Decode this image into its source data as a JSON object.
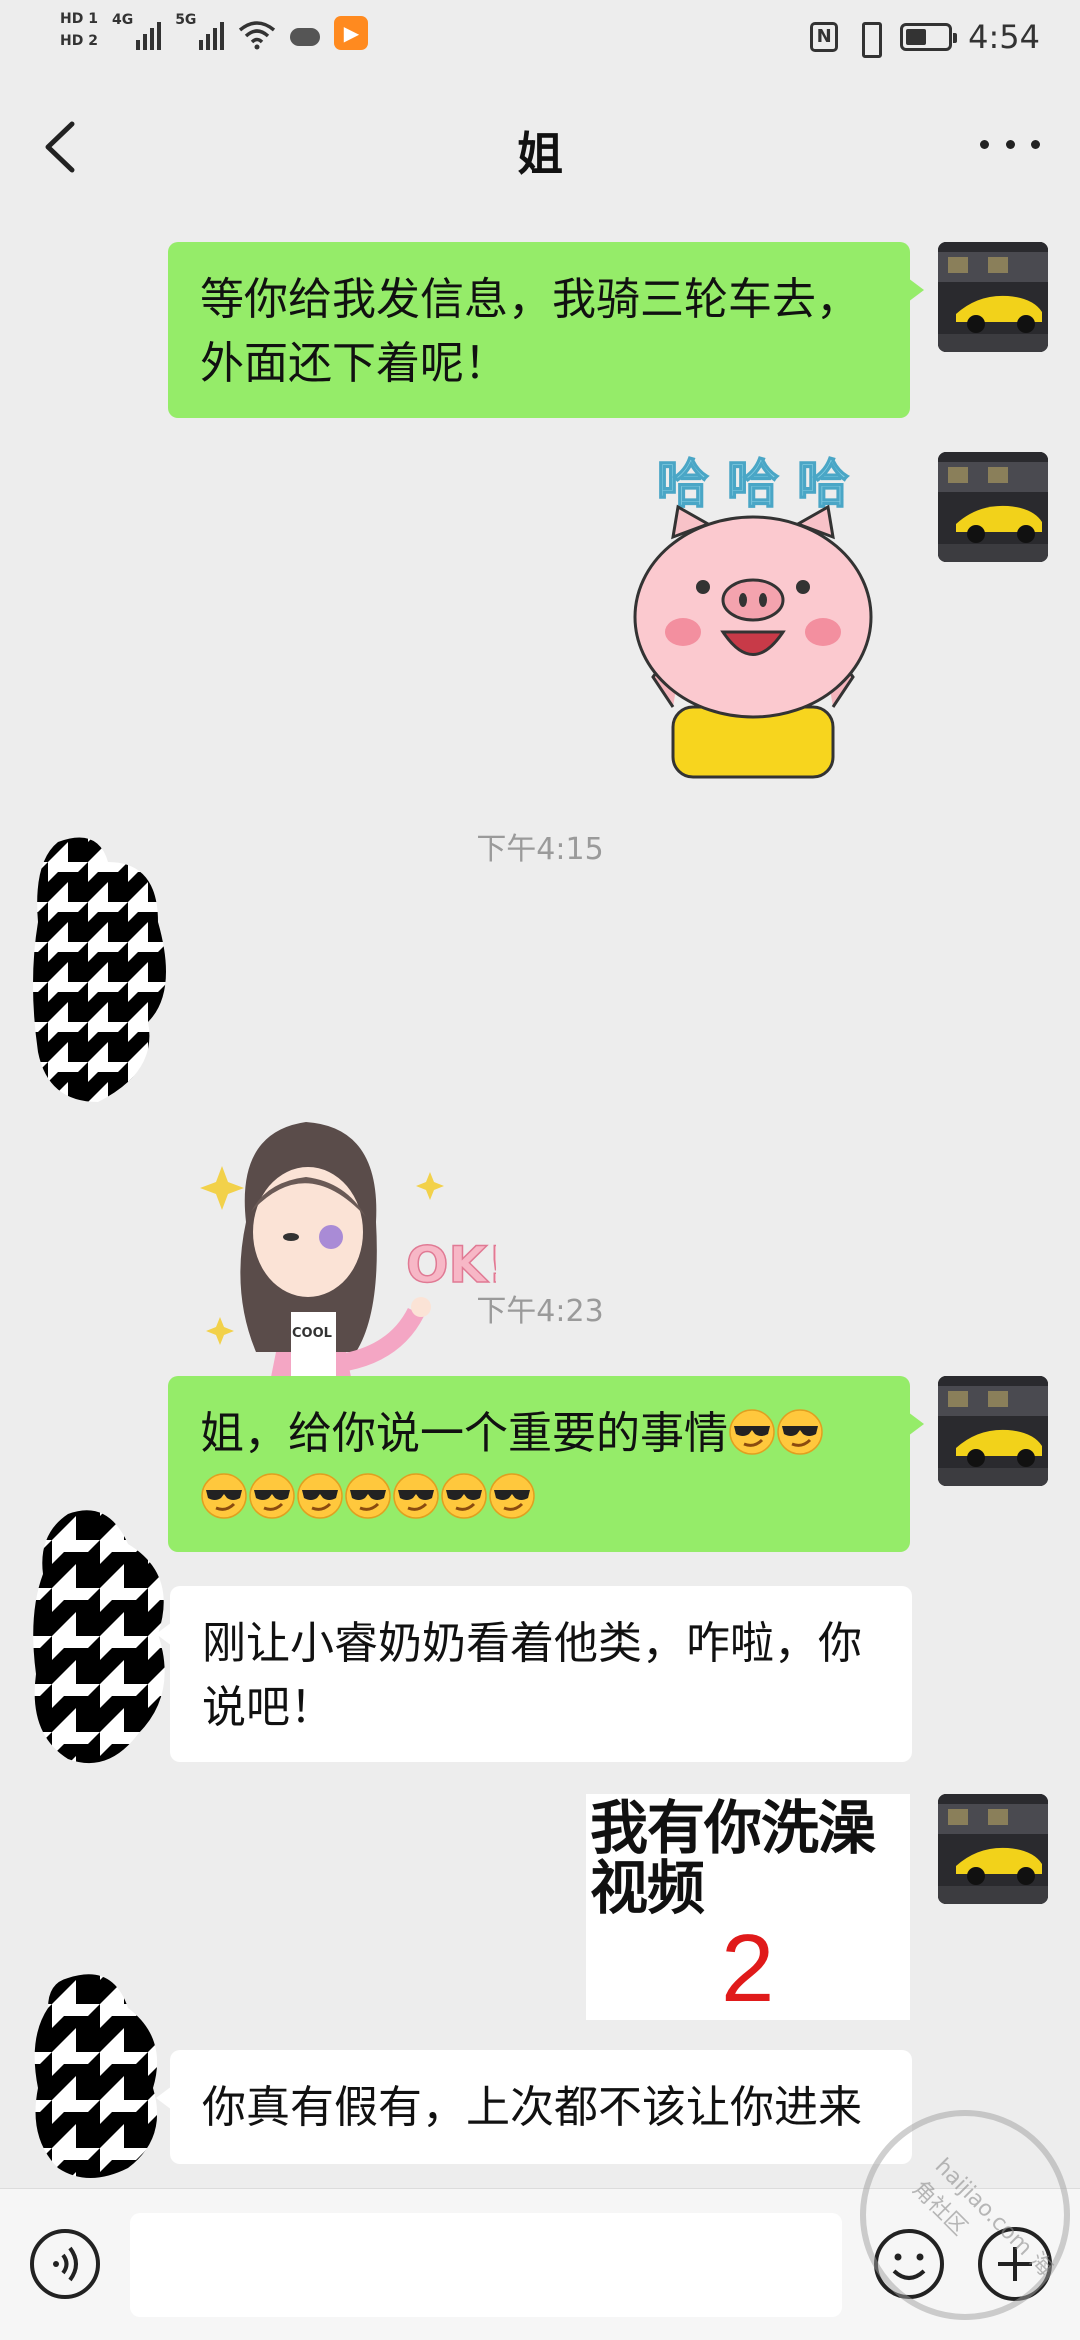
{
  "status_bar": {
    "sim1": "HD 1",
    "sim2": "HD 2",
    "net1": "4G",
    "net2": "5G",
    "nfc": "N",
    "time": "4:54"
  },
  "header": {
    "title": "姐"
  },
  "messages": [
    {
      "side": "me",
      "type": "text",
      "text": "等你给我发信息，我骑三轮车去，外面还下着呢！"
    },
    {
      "side": "me",
      "type": "sticker",
      "caption": "哈 哈 哈"
    },
    {
      "type": "time",
      "text": "下午4:15"
    },
    {
      "side": "other",
      "type": "sticker",
      "caption": "OK!"
    },
    {
      "type": "time",
      "text": "下午4:23"
    },
    {
      "side": "me",
      "type": "text",
      "text": "姐，给你说一个重要的事情"
    },
    {
      "side": "other",
      "type": "text",
      "text": "刚让小睿奶奶看着他类，咋啦，你说吧！"
    },
    {
      "side": "me",
      "type": "image",
      "line1": "我有你洗澡",
      "line2": "视频",
      "number": "2"
    },
    {
      "side": "other",
      "type": "text",
      "text": "你真有假有，上次都不该让你进来"
    }
  ],
  "sticker_labels": {
    "cool": "COOL"
  },
  "watermark": "haijiao.com 海角社区",
  "colors": {
    "my_bubble": "#95ec69",
    "other_bubble": "#ffffff",
    "background": "#ededed",
    "image_number": "#e01a1a"
  },
  "icons": {
    "voice": "voice-icon",
    "emoji": "emoji-icon",
    "plus": "plus-icon",
    "back": "back-chevron-icon",
    "more": "more-icon"
  }
}
